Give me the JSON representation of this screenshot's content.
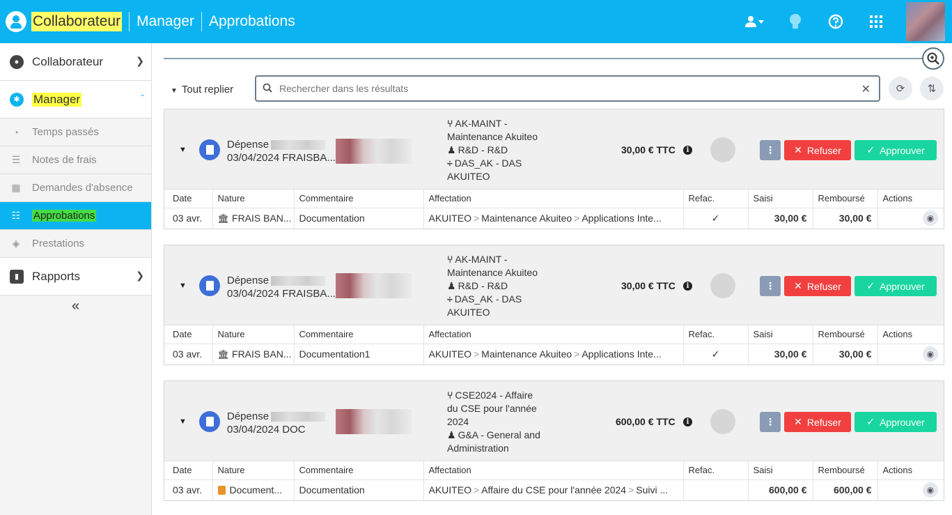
{
  "topbar": {
    "crumb_collaborateur": "Collaborateur",
    "crumb_manager": "Manager",
    "crumb_approbations": "Approbations",
    "icons": [
      "user-switch-icon",
      "lightbulb-icon",
      "help-icon",
      "apps-grid-icon"
    ]
  },
  "sidebar": {
    "collaborateur": "Collaborateur",
    "manager": "Manager",
    "items": [
      "Temps passés",
      "Notes de frais",
      "Demandes d'absence",
      "Approbations",
      "Prestations"
    ],
    "rapports": "Rapports",
    "collapse_glyph": "«"
  },
  "toolbar": {
    "collapse_all": "Tout replier",
    "search_placeholder": "Rechercher dans les résultats"
  },
  "colors": {
    "brand": "#0bb4f0",
    "refuse": "#f24040",
    "approve": "#19d6a0",
    "icon_blue": "#3e6fd8"
  },
  "columns": [
    "Date",
    "Nature",
    "Commentaire",
    "Affectation",
    "Refac.",
    "Saisi",
    "Remboursé",
    "Actions"
  ],
  "actions": {
    "refuse": "Refuser",
    "approve": "Approuver",
    "more": "⋮"
  },
  "cards": [
    {
      "type": "Dépense",
      "subtitle": "03/04/2024 FRAISBA...",
      "aff_lines": [
        {
          "glyph": "⑂",
          "text": "AK-MAINT -"
        },
        {
          "glyph": "",
          "text": "Maintenance Akuiteo"
        },
        {
          "glyph": "♟",
          "text": "R&D - R&D"
        },
        {
          "glyph": "÷",
          "text": "DAS_AK - DAS"
        },
        {
          "glyph": "",
          "text": "AKUITEO"
        }
      ],
      "amount": "30,00 € TTC",
      "row": {
        "date": "03 avr.",
        "nature": "FRAIS BAN...",
        "comment": "Documentation",
        "aff": [
          "AKUITEO",
          "Maintenance Akuiteo",
          "Applications Inte..."
        ],
        "refac": "✓",
        "saisi": "30,00 €",
        "rembourse": "30,00 €"
      }
    },
    {
      "type": "Dépense",
      "subtitle": "03/04/2024 FRAISBA...",
      "aff_lines": [
        {
          "glyph": "⑂",
          "text": "AK-MAINT -"
        },
        {
          "glyph": "",
          "text": "Maintenance Akuiteo"
        },
        {
          "glyph": "♟",
          "text": "R&D - R&D"
        },
        {
          "glyph": "÷",
          "text": "DAS_AK - DAS"
        },
        {
          "glyph": "",
          "text": "AKUITEO"
        }
      ],
      "amount": "30,00 € TTC",
      "row": {
        "date": "03 avr.",
        "nature": "FRAIS BAN...",
        "comment": "Documentation1",
        "aff": [
          "AKUITEO",
          "Maintenance Akuiteo",
          "Applications Inte..."
        ],
        "refac": "✓",
        "saisi": "30,00 €",
        "rembourse": "30,00 €"
      }
    },
    {
      "type": "Dépense",
      "subtitle": "03/04/2024 DOC",
      "aff_lines": [
        {
          "glyph": "⑂",
          "text": "CSE2024 - Affaire"
        },
        {
          "glyph": "",
          "text": "du CSE pour l'année"
        },
        {
          "glyph": "",
          "text": "2024"
        },
        {
          "glyph": "♟",
          "text": "G&A - General and"
        },
        {
          "glyph": "",
          "text": "Administration"
        }
      ],
      "amount": "600,00 € TTC",
      "row": {
        "date": "03 avr.",
        "nature": "Document...",
        "comment": "Documentation",
        "aff": [
          "AKUITEO",
          "Affaire du CSE pour l'année 2024",
          "Suivi ..."
        ],
        "refac": "",
        "saisi": "600,00 €",
        "rembourse": "600,00 €"
      }
    }
  ]
}
